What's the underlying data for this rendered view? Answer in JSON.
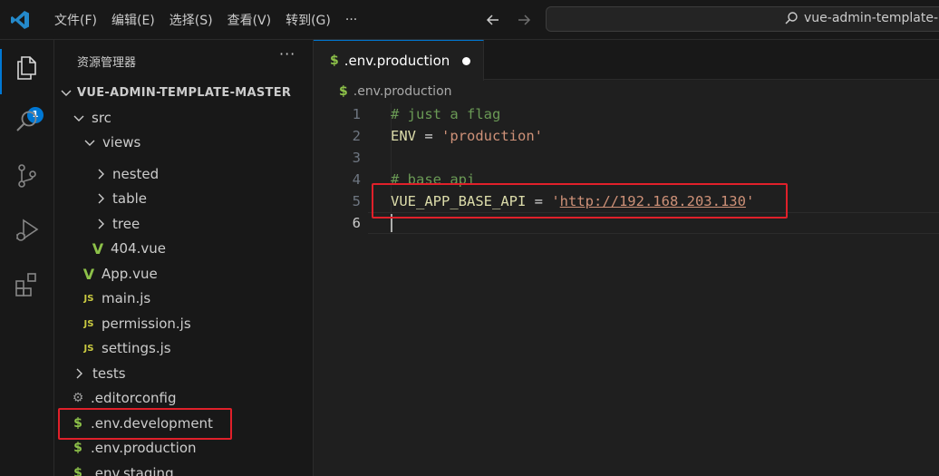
{
  "menu": [
    "文件(F)",
    "编辑(E)",
    "选择(S)",
    "查看(V)",
    "转到(G)",
    "···"
  ],
  "search": {
    "text": "vue-admin-template-m"
  },
  "activity": {
    "badge": "1"
  },
  "sidebar": {
    "title": "资源管理器",
    "more": "···",
    "root": "VUE-ADMIN-TEMPLATE-MASTER",
    "items": [
      {
        "label": "src",
        "kind": "folder-open"
      },
      {
        "label": "views",
        "kind": "folder-open"
      },
      {
        "label": "nested",
        "kind": "folder"
      },
      {
        "label": "table",
        "kind": "folder"
      },
      {
        "label": "tree",
        "kind": "folder"
      },
      {
        "label": "404.vue",
        "kind": "vue"
      },
      {
        "label": "App.vue",
        "kind": "vue"
      },
      {
        "label": "main.js",
        "kind": "js"
      },
      {
        "label": "permission.js",
        "kind": "js"
      },
      {
        "label": "settings.js",
        "kind": "js"
      },
      {
        "label": "tests",
        "kind": "folder"
      },
      {
        "label": ".editorconfig",
        "kind": "gear"
      },
      {
        "label": ".env.development",
        "kind": "env"
      },
      {
        "label": ".env.production",
        "kind": "env"
      },
      {
        "label": ".env.staging",
        "kind": "env"
      }
    ]
  },
  "icons": {
    "js": "JS",
    "env": "$",
    "vue": "V",
    "gear": "⚙"
  },
  "editor": {
    "tab_label": ".env.production",
    "breadcrumb": ".env.production",
    "lines": [
      {
        "n": "1",
        "text": "# just a flag"
      },
      {
        "n": "2",
        "key": "ENV",
        "op": " = ",
        "val": "'production'"
      },
      {
        "n": "3",
        "text": ""
      },
      {
        "n": "4",
        "text": "# base api"
      },
      {
        "n": "5",
        "key": "VUE_APP_BASE_API",
        "op": " = ",
        "q1": "'",
        "url": "http://192.168.203.130",
        "q2": "'"
      },
      {
        "n": "6",
        "text": ""
      }
    ]
  },
  "colors": {
    "accent": "#0078d4",
    "highlight": "#e0202a"
  }
}
